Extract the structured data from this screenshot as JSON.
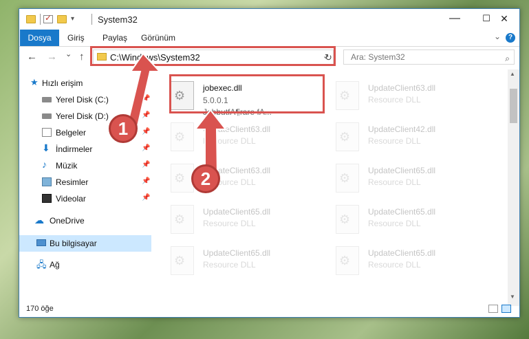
{
  "window": {
    "title": "System32",
    "minimize": "—",
    "maximize": "☐",
    "close": "✕"
  },
  "ribbon": {
    "tabs": [
      "Dosya",
      "Giriş",
      "Paylaş",
      "Görünüm"
    ],
    "help": "?"
  },
  "nav": {
    "back": "←",
    "forward": "→",
    "recent": "⌄",
    "up": "↑",
    "address": "C:\\Windows\\System32",
    "dropdown": "⌄",
    "refresh": "↻",
    "search_placeholder": "Ara: System32",
    "search_icon": "⌕"
  },
  "sidebar": {
    "items": [
      {
        "label": "Hızlı erişim",
        "icon": "star-icon"
      },
      {
        "label": "Yerel Disk (C:)",
        "icon": "disk-icon"
      },
      {
        "label": "Yerel Disk (D:)",
        "icon": "disk-icon"
      },
      {
        "label": "Belgeler",
        "icon": "documents-icon"
      },
      {
        "label": "İndirmeler",
        "icon": "download-icon"
      },
      {
        "label": "Müzik",
        "icon": "music-icon"
      },
      {
        "label": "Resimler",
        "icon": "pictures-icon"
      },
      {
        "label": "Videolar",
        "icon": "videos-icon"
      },
      {
        "label": "OneDrive",
        "icon": "cloud-icon"
      },
      {
        "label": "Bu bilgisayar",
        "icon": "computer-icon"
      },
      {
        "label": "Ağ",
        "icon": "network-icon"
      }
    ],
    "pin": "📌"
  },
  "files": [
    {
      "name": "jobexec.dll",
      "line2": "5.0.0.1",
      "line3": "JobbutfA¶rare fA..."
    },
    {
      "name": "UpdateClient63.dll",
      "line2": "Resource DLL"
    },
    {
      "name": "UpdateClient63.dll",
      "line2": "Resource DLL"
    },
    {
      "name": "UpdateClient42.dll",
      "line2": "Resource DLL"
    },
    {
      "name": "UpdateClient63.dll",
      "line2": "Resource DLL"
    },
    {
      "name": "UpdateClient65.dll",
      "line2": "Resource DLL"
    },
    {
      "name": "UpdateClient65.dll",
      "line2": "Resource DLL"
    },
    {
      "name": "UpdateClient65.dll",
      "line2": "Resource DLL"
    },
    {
      "name": "UpdateClient65.dll",
      "line2": "Resource DLL"
    },
    {
      "name": "UpdateClient65.dll",
      "line2": "Resource DLL"
    }
  ],
  "status": {
    "count": "170 öğe"
  },
  "annotations": {
    "badge1": "1",
    "badge2": "2",
    "color": "#d9534f"
  }
}
